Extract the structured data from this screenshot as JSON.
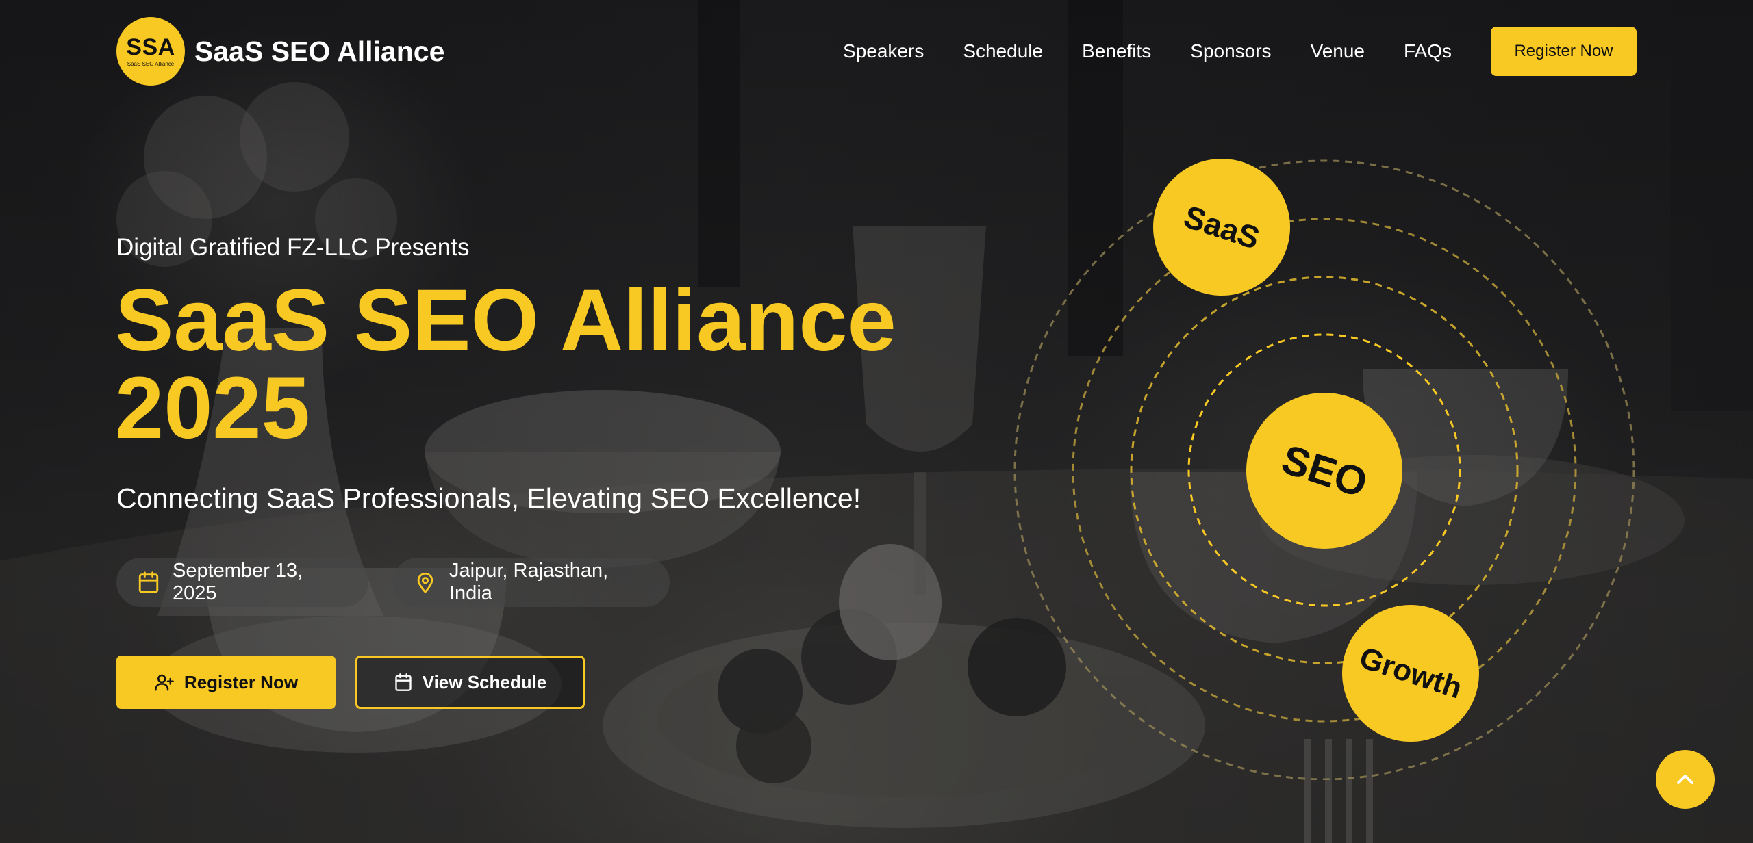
{
  "header": {
    "logo_abbr": "SSA",
    "logo_sub": "SaaS SEO Alliance",
    "brand_name": "SaaS SEO Alliance",
    "nav": [
      "Speakers",
      "Schedule",
      "Benefits",
      "Sponsors",
      "Venue",
      "FAQs"
    ],
    "cta_label": "Register Now"
  },
  "hero": {
    "presenter": "Digital Gratified FZ-LLC Presents",
    "title_line1": "SaaS SEO Alliance",
    "title_line2": "2025",
    "tagline": "Connecting SaaS Professionals, Elevating SEO Excellence!",
    "date": "September 13, 2025",
    "location": "Jaipur, Rajasthan, India",
    "primary_button": "Register Now",
    "secondary_button": "View Schedule"
  },
  "orbit": {
    "bubbles": [
      "SaaS",
      "SEO",
      "Growth"
    ]
  },
  "icons": {
    "date": "calendar-icon",
    "location": "map-pin-icon",
    "register": "user-plus-icon",
    "schedule": "calendar-icon",
    "scroll": "chevron-up-icon"
  },
  "colors": {
    "accent": "#f8c923",
    "text": "#ffffff",
    "dark": "#111111"
  }
}
